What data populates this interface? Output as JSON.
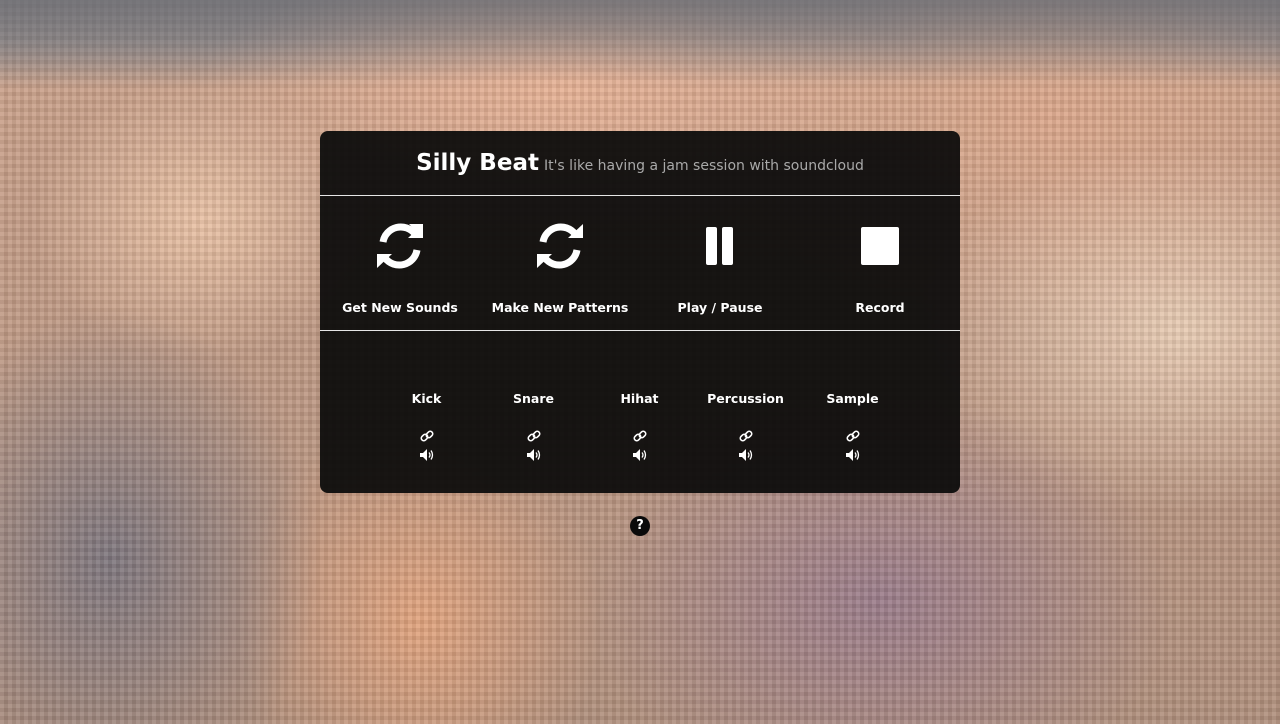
{
  "header": {
    "title": "Silly Beat",
    "subtitle": "It's like having a jam session with soundcloud"
  },
  "controls": [
    {
      "label": "Get New Sounds",
      "icon": "refresh-icon"
    },
    {
      "label": "Make New Patterns",
      "icon": "refresh-icon"
    },
    {
      "label": "Play / Pause",
      "icon": "pause-icon"
    },
    {
      "label": "Record",
      "icon": "stop-icon"
    }
  ],
  "tracks": [
    {
      "label": "Kick"
    },
    {
      "label": "Snare"
    },
    {
      "label": "Hihat"
    },
    {
      "label": "Percussion"
    },
    {
      "label": "Sample"
    }
  ],
  "help": {
    "icon": "question-icon",
    "glyph": "?"
  },
  "colors": {
    "panel": "#0a0a0a",
    "text": "#ffffff",
    "subtitle": "#a9a9a9",
    "divider": "#e6e6e6"
  }
}
